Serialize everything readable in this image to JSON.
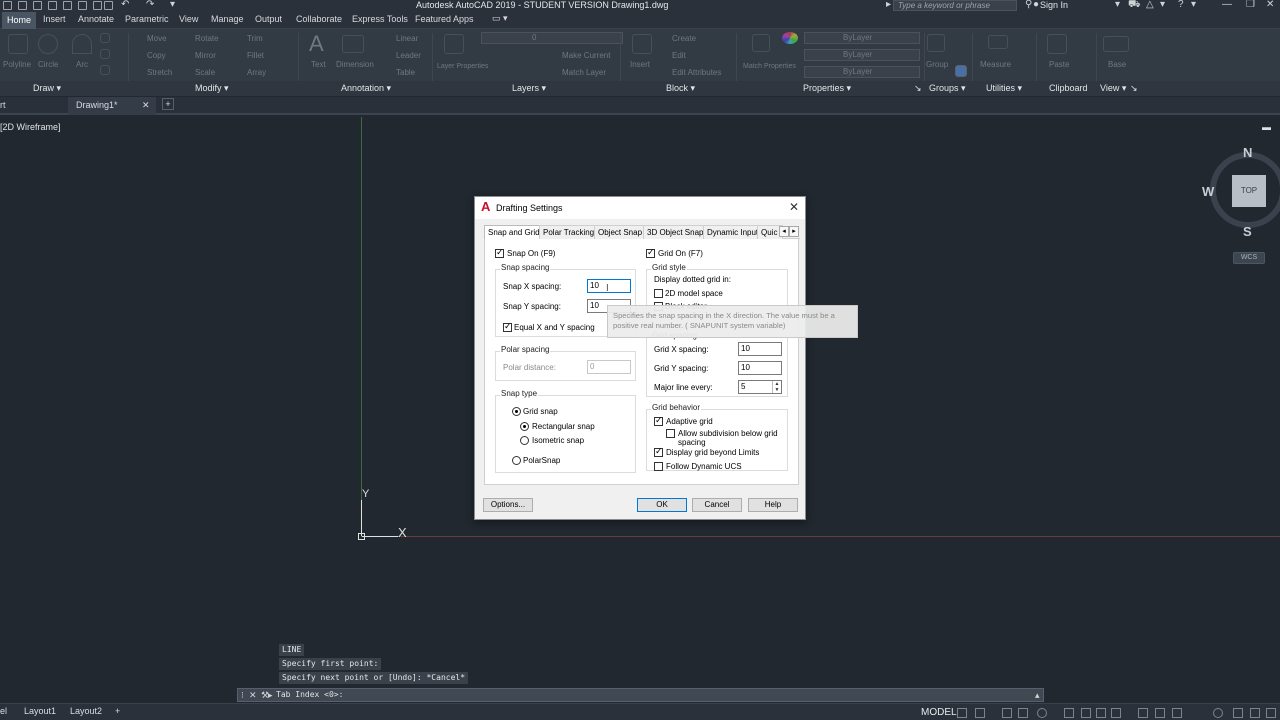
{
  "titlebar": {
    "app_title": "Autodesk AutoCAD 2019 - STUDENT VERSION    Drawing1.dwg",
    "search_placeholder": "Type a keyword or phrase",
    "sign_in": "Sign In"
  },
  "ribbon_tabs": [
    "Home",
    "Insert",
    "Annotate",
    "Parametric",
    "View",
    "Manage",
    "Output",
    "Collaborate",
    "Express Tools",
    "Featured Apps"
  ],
  "ribbon_tools": {
    "draw": [
      "Polyline",
      "Circle",
      "Arc"
    ],
    "modify": [
      "Move",
      "Rotate",
      "Trim",
      "Copy",
      "Mirror",
      "Fillet",
      "Stretch",
      "Scale",
      "Array"
    ],
    "annotation": [
      "Text",
      "Dimension",
      "Linear",
      "Leader",
      "Table"
    ],
    "layers": [
      "Layer Properties",
      "Make Current",
      "Match Layer"
    ],
    "layer_value": "0",
    "block": [
      "Insert",
      "Create",
      "Edit",
      "Edit Attributes"
    ],
    "properties": [
      "Match Properties",
      "ByLayer",
      "ByLayer",
      "ByLayer"
    ],
    "groups": [
      "Group"
    ],
    "utilities": [
      "Measure"
    ],
    "clipboard": [
      "Paste"
    ],
    "view": [
      "Base"
    ]
  },
  "ribbon_panels": [
    "Draw",
    "Modify",
    "Annotation",
    "Layers",
    "Block",
    "Properties",
    "Groups",
    "Utilities",
    "Clipboard",
    "View"
  ],
  "doc_tabs": {
    "start_tab": "rt",
    "active_tab": "Drawing1*",
    "add_tab": "+"
  },
  "viewport": {
    "view_label": "[2D Wireframe]",
    "ucs_y": "Y",
    "ucs_x": "X",
    "viewcube": {
      "north": "N",
      "south": "S",
      "west": "W",
      "top": "TOP",
      "wcs": "WCS"
    }
  },
  "command_history": [
    "LINE",
    "Specify first point:",
    "Specify next point or [Undo]: *Cancel*"
  ],
  "command_input": "Tab Index <0>:",
  "statusbar": {
    "layout_tabs": [
      "el",
      "Layout1",
      "Layout2",
      "+"
    ],
    "model_label": "MODEL"
  },
  "dialog": {
    "title": "Drafting Settings",
    "tabs": [
      "Snap and Grid",
      "Polar Tracking",
      "Object Snap",
      "3D Object Snap",
      "Dynamic Input",
      "Quic"
    ],
    "snap_on": {
      "label": "Snap On (F9)",
      "checked": true
    },
    "snap_spacing": {
      "title": "Snap spacing",
      "x_label": "Snap X spacing:",
      "x_value": "10",
      "y_label": "Snap Y spacing:",
      "y_value": "10",
      "equal_label": "Equal X and Y spacing"
    },
    "polar_spacing": {
      "title": "Polar spacing",
      "distance_label": "Polar distance:",
      "distance_value": "0"
    },
    "snap_type": {
      "title": "Snap type",
      "grid_snap": "Grid snap",
      "rectangular": "Rectangular snap",
      "isometric": "Isometric snap",
      "polar": "PolarSnap"
    },
    "grid_on": {
      "label": "Grid On (F7)",
      "checked": true
    },
    "grid_style": {
      "title": "Grid style",
      "display_label": "Display dotted grid in:",
      "model_space": "2D model space",
      "block_editor": "Block editor"
    },
    "grid_spacing": {
      "title": "Grid spacing",
      "x_label": "Grid X spacing:",
      "x_value": "10",
      "y_label": "Grid Y spacing:",
      "y_value": "10",
      "major_label": "Major line every:",
      "major_value": "5"
    },
    "grid_behavior": {
      "title": "Grid behavior",
      "adaptive": "Adaptive grid",
      "subdivision": "Allow subdivision below grid spacing",
      "beyond_limits": "Display grid beyond Limits",
      "follow_ucs": "Follow Dynamic UCS"
    },
    "buttons": {
      "options": "Options...",
      "ok": "OK",
      "cancel": "Cancel",
      "help": "Help"
    },
    "tooltip": "Specifies the snap spacing in the X direction. The value must be a positive real number. ( SNAPUNIT system variable)"
  },
  "colors": {
    "canvas": "#212830",
    "ribbon": "#323a44",
    "accent_blue": "#0078d7",
    "autocad_red": "#c8102e"
  }
}
